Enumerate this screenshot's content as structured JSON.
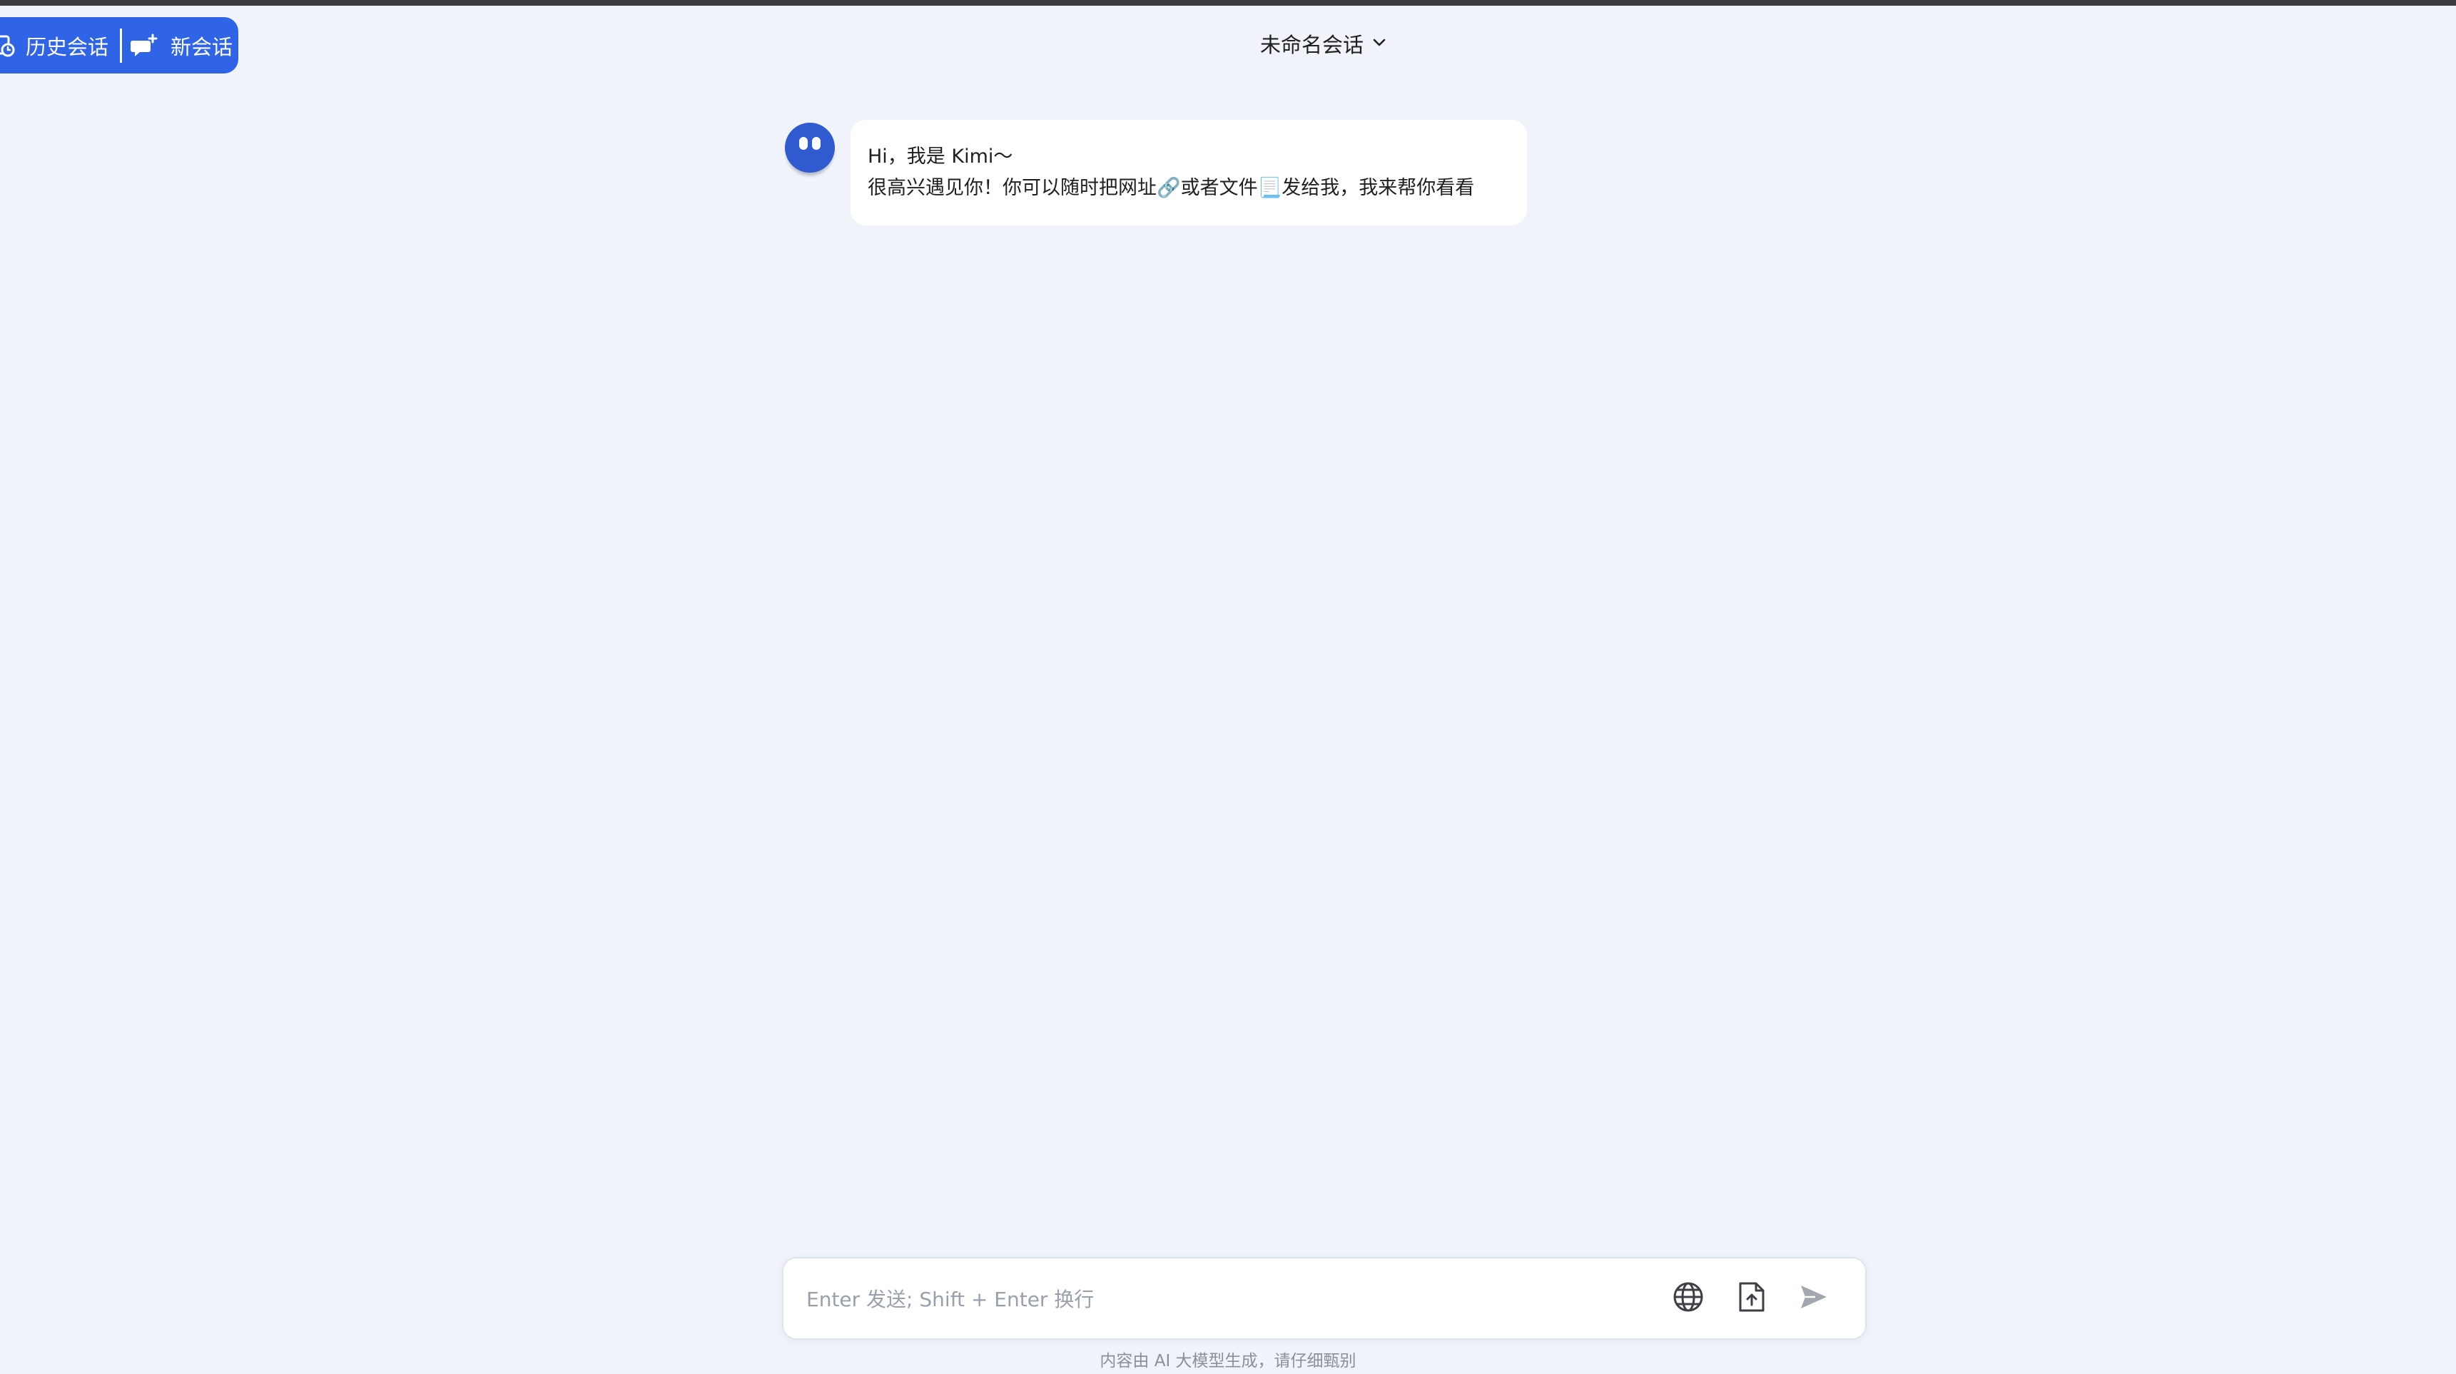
{
  "top_actions": {
    "history_label": "历史会话",
    "new_chat_label": "新会话",
    "history_icon": "history-clock-icon",
    "new_chat_icon": "new-chat-icon"
  },
  "header": {
    "title": "未命名会话",
    "dropdown_icon": "chevron-down-icon"
  },
  "messages": [
    {
      "sender": "assistant",
      "avatar_icon": "kimi-avatar",
      "lines": [
        "Hi，我是 Kimi～",
        "很高兴遇见你！你可以随时把网址🔗或者文件📃发给我，我来帮你看看"
      ]
    }
  ],
  "composer": {
    "value": "",
    "placeholder": "Enter 发送; Shift + Enter 换行",
    "tools": [
      "globe-icon",
      "upload-file-icon",
      "send-icon"
    ]
  },
  "footer": {
    "disclaimer": "内容由 AI 大模型生成，请仔细甄别"
  },
  "colors": {
    "background": "#f0f3f9",
    "accent": "#2f64e6",
    "avatar": "#2f5ad0",
    "bubble": "#ffffff",
    "muted_text": "#8a8f99"
  }
}
